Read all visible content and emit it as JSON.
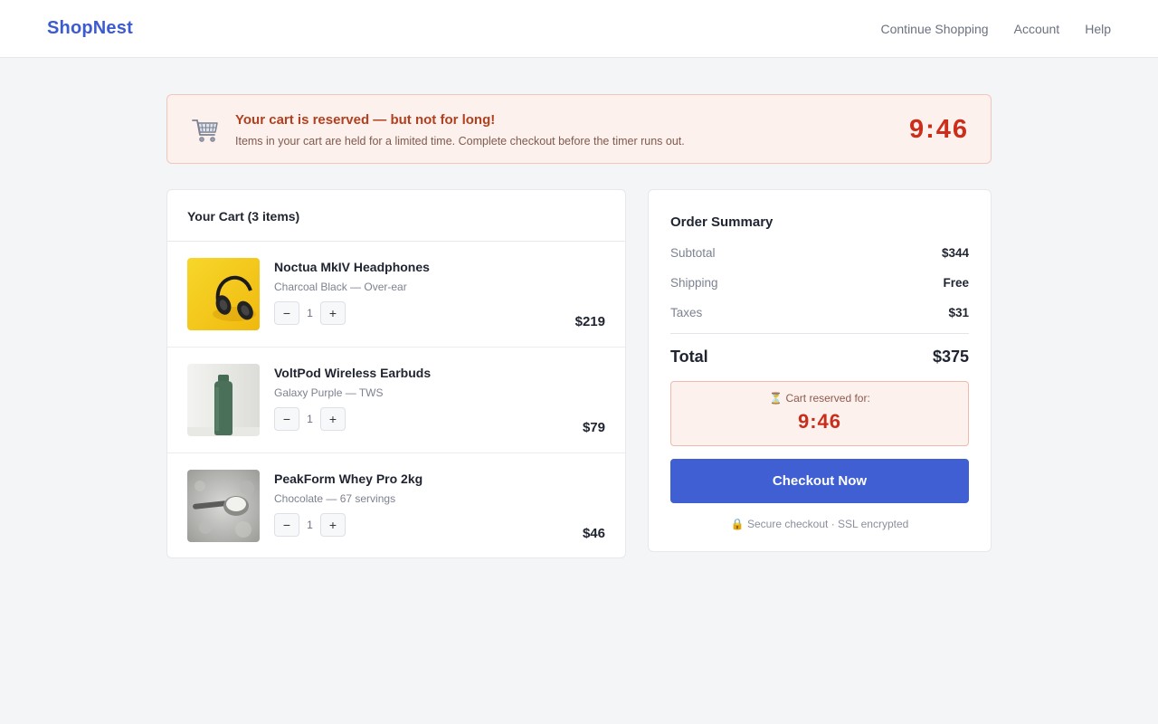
{
  "header": {
    "brand": "ShopNest",
    "nav": [
      "Continue Shopping",
      "Account",
      "Help"
    ]
  },
  "banner": {
    "icon": "shopping-cart-icon",
    "title": "Your cart is reserved — but not for long!",
    "text": "Items in your cart are held for a limited time. Complete checkout before the timer runs out.",
    "timer": "9:46"
  },
  "cart": {
    "title": "Your Cart (3 items)",
    "items": [
      {
        "name": "Noctua MkIV Headphones",
        "variant": "Charcoal Black — Over-ear",
        "qty": "1",
        "price": "$219",
        "image": "headphones-on-yellow"
      },
      {
        "name": "VoltPod Wireless Earbuds",
        "variant": "Galaxy Purple — TWS",
        "qty": "1",
        "price": "$79",
        "image": "green-bottle"
      },
      {
        "name": "PeakForm Whey Pro 2kg",
        "variant": "Chocolate — 67 servings",
        "qty": "1",
        "price": "$46",
        "image": "powder-scoop"
      }
    ],
    "minus": "−",
    "plus": "+"
  },
  "summary": {
    "title": "Order Summary",
    "subtotal_label": "Subtotal",
    "subtotal": "$344",
    "shipping_label": "Shipping",
    "shipping": "Free",
    "taxes_label": "Taxes",
    "taxes": "$31",
    "total_label": "Total",
    "total": "$375",
    "reserved_label": "⏳ Cart reserved for:",
    "reserved_timer": "9:46",
    "checkout_label": "Checkout Now",
    "secure_note": "🔒 Secure checkout · SSL encrypted"
  },
  "colors": {
    "brand": "#3d5bd1",
    "checkout_button": "#3f5fd2",
    "timer": "#cc2e1c",
    "banner_bg": "#fdf1ee"
  }
}
